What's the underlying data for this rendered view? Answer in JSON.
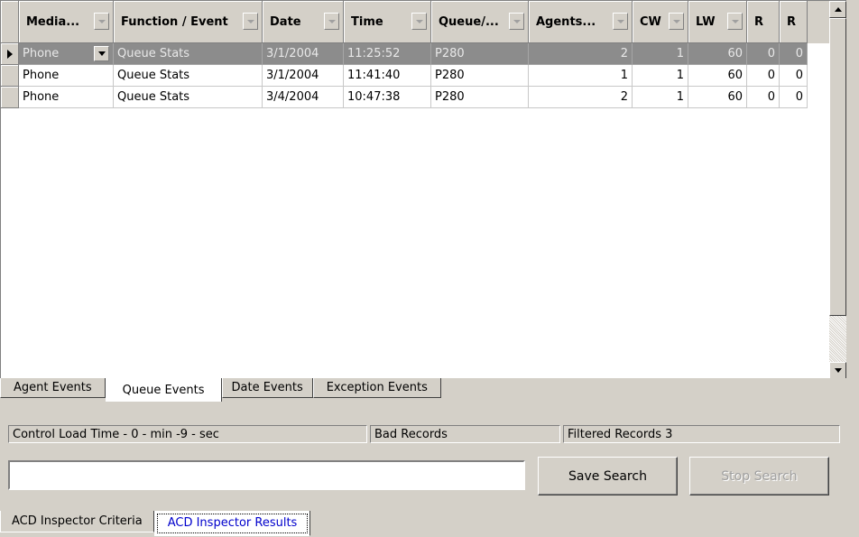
{
  "grid": {
    "columns": [
      {
        "label": "Media...",
        "has_filter": true
      },
      {
        "label": "Function / Event",
        "has_filter": true
      },
      {
        "label": "Date",
        "has_filter": true
      },
      {
        "label": "Time",
        "has_filter": true
      },
      {
        "label": "Queue/...",
        "has_filter": true
      },
      {
        "label": "Agents...",
        "has_filter": true
      },
      {
        "label": "CW",
        "has_filter": true
      },
      {
        "label": "LW",
        "has_filter": true
      },
      {
        "label": "R",
        "has_filter": false
      },
      {
        "label": "R",
        "has_filter": false
      }
    ],
    "rows": [
      {
        "selected": true,
        "cells": [
          "Phone",
          "Queue Stats",
          "3/1/2004",
          "11:25:52",
          "P280",
          "2",
          "1",
          "60",
          "0",
          "0"
        ]
      },
      {
        "selected": false,
        "cells": [
          "Phone",
          "Queue Stats",
          "3/1/2004",
          "11:41:40",
          "P280",
          "1",
          "1",
          "60",
          "0",
          "0"
        ]
      },
      {
        "selected": false,
        "cells": [
          "Phone",
          "Queue Stats",
          "3/4/2004",
          "10:47:38",
          "P280",
          "2",
          "1",
          "60",
          "0",
          "0"
        ]
      }
    ]
  },
  "inner_tabs": [
    {
      "label": "Agent Events",
      "active": false
    },
    {
      "label": "Queue Events",
      "active": true
    },
    {
      "label": "Date Events",
      "active": false
    },
    {
      "label": "Exception Events",
      "active": false
    }
  ],
  "status": {
    "load_time": "Control Load Time - 0 - min -9 - sec",
    "bad_records": "Bad Records",
    "filtered_records": "Filtered Records 3"
  },
  "search": {
    "value": "",
    "placeholder": "",
    "save_label": "Save Search",
    "stop_label": "Stop Search"
  },
  "outer_tabs": [
    {
      "label": "ACD Inspector Criteria",
      "active": false
    },
    {
      "label": "ACD Inspector Results",
      "active": true
    }
  ],
  "colors": {
    "selected_row": "#8c8c8c",
    "face": "#d4d0c8",
    "active_tab_text": "#0000cc"
  }
}
